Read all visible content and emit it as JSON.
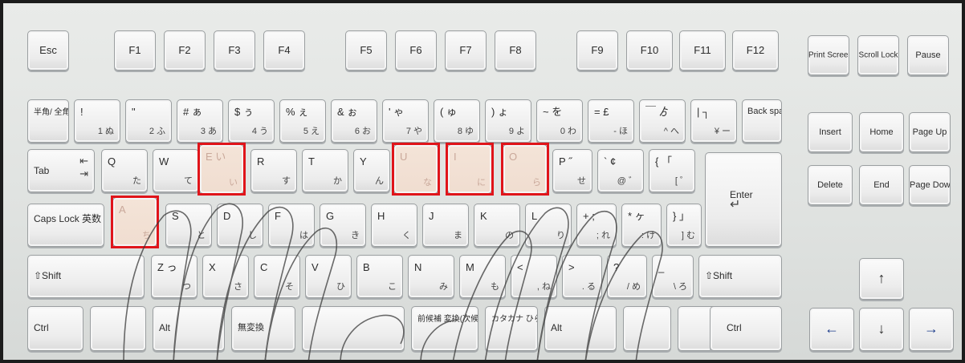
{
  "keyboard": {
    "row_fn": {
      "esc": "Esc",
      "f": [
        "F1",
        "F2",
        "F3",
        "F4",
        "F5",
        "F6",
        "F7",
        "F8",
        "F9",
        "F10",
        "F11",
        "F12"
      ],
      "print": "Print\nScreen",
      "scroll": "Scroll\nLock",
      "pause": "Pause"
    },
    "row_num": [
      {
        "main": "半角/\n全角",
        "sub": ""
      },
      {
        "main": "!",
        "sub": "1 ぬ"
      },
      {
        "main": "\"",
        "sub": "2 ふ"
      },
      {
        "main": "# ぁ",
        "sub": "3 あ"
      },
      {
        "main": "$ ぅ",
        "sub": "4 う"
      },
      {
        "main": "% ぇ",
        "sub": "5 え"
      },
      {
        "main": "& ぉ",
        "sub": "6 お"
      },
      {
        "main": "' ゃ",
        "sub": "7 や"
      },
      {
        "main": "( ゅ",
        "sub": "8 ゆ"
      },
      {
        "main": ") ょ",
        "sub": "9 よ"
      },
      {
        "main": "~ を",
        "sub": "0 わ"
      },
      {
        "main": "= £",
        "sub": "- ほ"
      },
      {
        "main": "￣ ゟ",
        "sub": "^ へ"
      },
      {
        "main": "| ┐",
        "sub": "¥ ー"
      }
    ],
    "backspace": "Back\nspace",
    "insert": "Insert",
    "home": "Home",
    "page_up": "Page\nUp",
    "row_q": [
      {
        "main": "Q",
        "sub": "た"
      },
      {
        "main": "W",
        "sub": "て"
      },
      {
        "main": "E い",
        "sub": "い"
      },
      {
        "main": "R",
        "sub": "す"
      },
      {
        "main": "T",
        "sub": "か"
      },
      {
        "main": "Y",
        "sub": "ん"
      },
      {
        "main": "U",
        "sub": "な"
      },
      {
        "main": "I",
        "sub": "に"
      },
      {
        "main": "O",
        "sub": "ら"
      },
      {
        "main": "P ˝",
        "sub": "せ"
      },
      {
        "main": "` ¢",
        "sub": "@ ゛"
      },
      {
        "main": "{ 「",
        "sub": "[ ゜"
      }
    ],
    "tab": "Tab",
    "enter": "Enter",
    "delete": "Delete",
    "end": "End",
    "page_down": "Page\nDown",
    "caps": "Caps Lock\n英数",
    "row_a": [
      {
        "main": "A",
        "sub": "ち"
      },
      {
        "main": "S",
        "sub": "と"
      },
      {
        "main": "D",
        "sub": "し"
      },
      {
        "main": "F",
        "sub": "は"
      },
      {
        "main": "G",
        "sub": "き"
      },
      {
        "main": "H",
        "sub": "く"
      },
      {
        "main": "J",
        "sub": "ま"
      },
      {
        "main": "K",
        "sub": "の"
      },
      {
        "main": "L",
        "sub": "り"
      },
      {
        "main": "+ ;",
        "sub": "; れ"
      },
      {
        "main": "* ヶ",
        "sub": ": け"
      },
      {
        "main": "} 」",
        "sub": "] む"
      }
    ],
    "shift_l": "⇧Shift",
    "row_z": [
      {
        "main": "Z っ",
        "sub": "つ"
      },
      {
        "main": "X",
        "sub": "さ"
      },
      {
        "main": "C",
        "sub": "そ"
      },
      {
        "main": "V",
        "sub": "ひ"
      },
      {
        "main": "B",
        "sub": "こ"
      },
      {
        "main": "N",
        "sub": "み"
      },
      {
        "main": "M",
        "sub": "も"
      },
      {
        "main": "<",
        "sub": ", ね"
      },
      {
        "main": ">",
        "sub": ". る"
      },
      {
        "main": "?",
        "sub": "/ め"
      },
      {
        "main": "_",
        "sub": "\\ ろ"
      }
    ],
    "shift_r": "⇧Shift",
    "ctrl_l": "Ctrl",
    "alt_l": "Alt",
    "muhenkan": "無変換",
    "henkan": "前候補\n変換(次候補)",
    "kana": "カタカナ\nひらがな",
    "alt_r": "Alt",
    "ctrl_r": "Ctrl",
    "arrows": {
      "up": "↑",
      "left": "←",
      "down": "↓",
      "right": "→"
    }
  },
  "colors": {
    "highlight_border": "#e0141a",
    "highlight_key": "#f0ddd0"
  }
}
